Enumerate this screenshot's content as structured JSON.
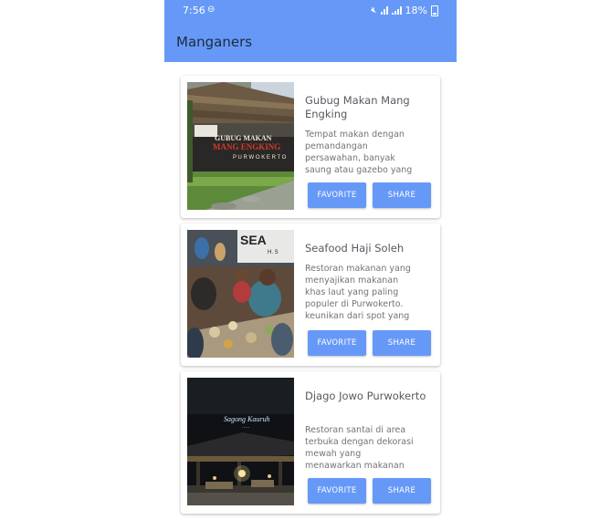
{
  "status_bar": {
    "time": "7:56",
    "battery": "18%"
  },
  "app": {
    "title": "Manganers"
  },
  "colors": {
    "accent": "#6699f7",
    "background": "#ffffff"
  },
  "restaurants": [
    {
      "name": "Gubug Makan Mang Engking",
      "description": "Tempat makan dengan pemandangan persawahan, banyak saung atau gazebo yang",
      "image_sign": "GUBUG MAKAN MANG ENGKING",
      "image_subsign": "PURWOKERTO",
      "favorite_label": "FAVORITE",
      "share_label": "SHARE"
    },
    {
      "name": "Seafood Haji Soleh",
      "description": "Restoran makanan yang menyajikan makanan khas laut yang paling populer di Purwokerto. keunikan dari spot yang membuat ...",
      "image_sign": "SEA H. S",
      "favorite_label": "FAVORITE",
      "share_label": "SHARE"
    },
    {
      "name": "Djago Jowo Purwokerto",
      "description": "Restoran santai di area terbuka dengan dekorasi mewah yang menawarkan makanan dan musik",
      "image_sign": "Sagong Kauruh",
      "favorite_label": "FAVORITE",
      "share_label": "SHARE"
    }
  ]
}
